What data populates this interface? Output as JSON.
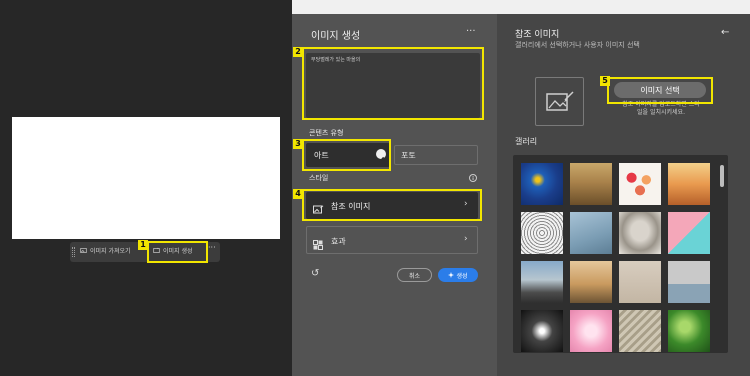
{
  "context_bar": {
    "item1_label": "이미지 가져오기",
    "item2_label": "이미지 생성",
    "more_label": "···"
  },
  "annotations": {
    "badge1": "1",
    "badge2": "2",
    "badge3": "3",
    "badge4": "4",
    "badge5": "5"
  },
  "generate_panel": {
    "title": "이미지 생성",
    "more_label": "···",
    "prompt_value": "무당벌레가 있는 마을의",
    "content_type_label": "콘텐츠 유형",
    "content_types": [
      {
        "label": "아트",
        "selected": true
      },
      {
        "label": "포토",
        "selected": false
      }
    ],
    "style_label": "스타일",
    "reference_row_label": "참조 이미지",
    "effects_row_label": "효과",
    "cancel_label": "취소",
    "generate_label": "생성"
  },
  "reference_panel": {
    "title": "참조 이미지",
    "subtitle": "갤러리에서 선택하거나 사용자 이미지 선택",
    "select_image_label": "이미지 선택",
    "hint_text": "참조 이미지를 업로드하면 스타일을 일치시키세요.",
    "gallery_label": "갤러리"
  },
  "colors": {
    "highlight": "#f2e600",
    "accent_blue": "#2b7de9",
    "panel_dark": "#535353",
    "panel_right": "#464646"
  }
}
